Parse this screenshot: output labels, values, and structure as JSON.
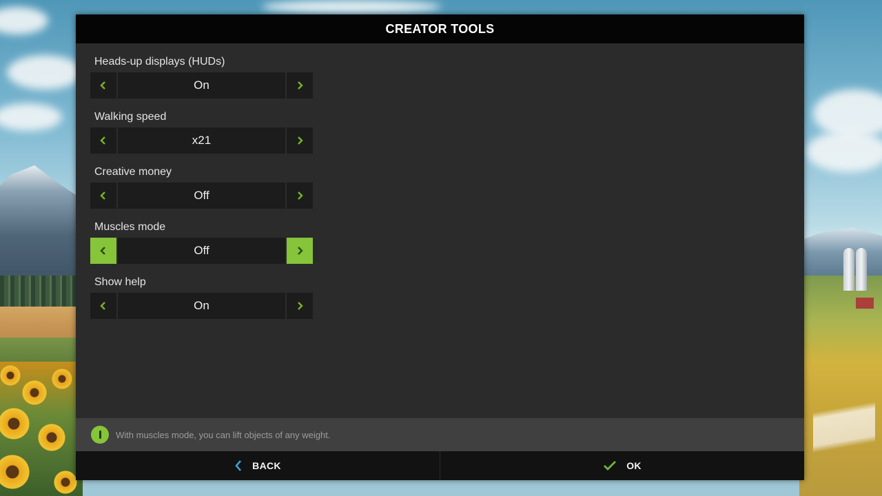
{
  "dialog": {
    "title": "CREATOR TOOLS"
  },
  "settings": [
    {
      "label": "Heads-up displays (HUDs)",
      "value": "On",
      "active": false
    },
    {
      "label": "Walking speed",
      "value": "x21",
      "active": false
    },
    {
      "label": "Creative money",
      "value": "Off",
      "active": false
    },
    {
      "label": "Muscles mode",
      "value": "Off",
      "active": true
    },
    {
      "label": "Show help",
      "value": "On",
      "active": false
    }
  ],
  "icons": {
    "prev": "chevron-left-icon",
    "next": "chevron-right-icon",
    "info": "info-icon",
    "back": "chevron-left-icon",
    "ok": "checkmark-icon"
  },
  "help": {
    "text": "With muscles mode, you can lift objects of any weight."
  },
  "footer": {
    "back_label": "BACK",
    "ok_label": "OK"
  },
  "colors": {
    "accent_green": "#86c43a",
    "arrow_green": "#78b428",
    "back_blue": "#3a9fd4",
    "panel_bg": "#2b2b2b",
    "header_bg": "#050505"
  }
}
